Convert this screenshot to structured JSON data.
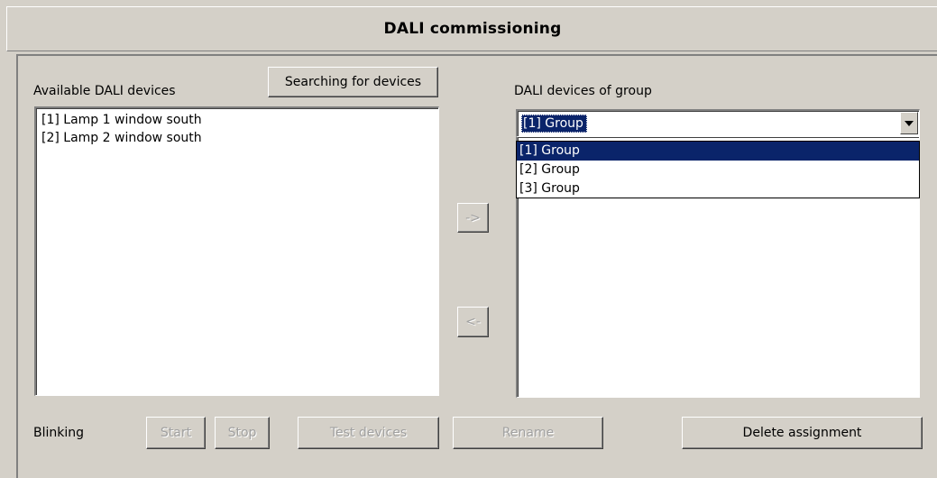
{
  "window": {
    "title": "DALI commissioning"
  },
  "left": {
    "label": "Available DALI devices",
    "search_button": "Searching for devices",
    "devices": [
      "[1] Lamp 1 window south",
      "[2] Lamp 2 window south"
    ]
  },
  "middle": {
    "add_button": "->",
    "remove_button": "<-"
  },
  "right": {
    "label": "DALI devices of group",
    "selected_group": "[1] Group",
    "group_options": [
      "[1] Group",
      "[2] Group",
      "[3] Group"
    ]
  },
  "footer": {
    "blinking_label": "Blinking",
    "start_button": "Start",
    "stop_button": "Stop",
    "test_devices_button": "Test devices",
    "rename_button": "Rename",
    "delete_assignment_button": "Delete assignment"
  },
  "colors": {
    "window_bg": "#d4d0c8",
    "selection": "#0a246a"
  }
}
